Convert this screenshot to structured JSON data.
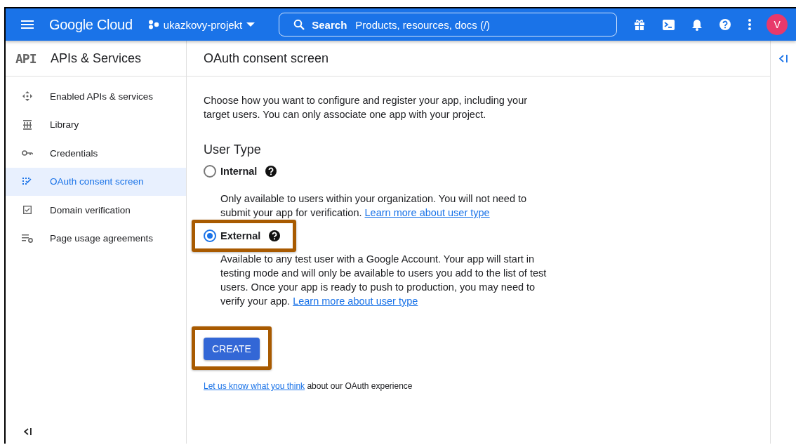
{
  "header": {
    "logo": "Google Cloud",
    "project": "ukazkovy-projekt",
    "search": {
      "label": "Search",
      "placeholder": "Products, resources, docs (/)"
    },
    "avatar": "V"
  },
  "sidebar": {
    "logo": "API",
    "title": "APIs & Services",
    "items": [
      {
        "label": "Enabled APIs & services",
        "kind": "apis",
        "selected": false
      },
      {
        "label": "Library",
        "kind": "library",
        "selected": false
      },
      {
        "label": "Credentials",
        "kind": "key",
        "selected": false
      },
      {
        "label": "OAuth consent screen",
        "kind": "consent",
        "selected": true
      },
      {
        "label": "Domain verification",
        "kind": "domain",
        "selected": false
      },
      {
        "label": "Page usage agreements",
        "kind": "agreements",
        "selected": false
      }
    ]
  },
  "page": {
    "title": "OAuth consent screen",
    "intro": "Choose how you want to configure and register your app, including your target users. You can only associate one app with your project.",
    "heading": "User Type",
    "options": [
      {
        "label": "Internal",
        "selected": false,
        "highlighted": false,
        "description": "Only available to users within your organization. You will not need to submit your app for verification.",
        "link": "Learn more about user type"
      },
      {
        "label": "External",
        "selected": true,
        "highlighted": true,
        "description": "Available to any test user with a Google Account. Your app will start in testing mode and will only be available to users you add to the list of test users. Once your app is ready to push to production, you may need to verify your app.",
        "link": "Learn more about user type"
      }
    ],
    "create_button": {
      "label": "CREATE",
      "highlighted": true
    },
    "feedback": {
      "link": "Let us know what you think",
      "text": "about our OAuth experience"
    }
  }
}
